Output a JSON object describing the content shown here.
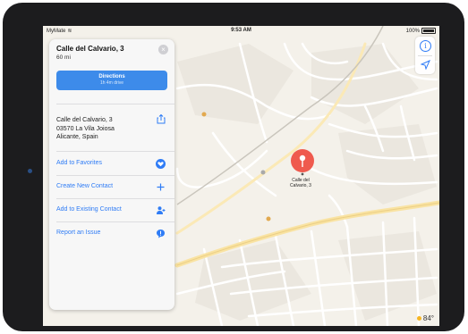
{
  "status": {
    "carrier": "MyMate",
    "time": "9:53 AM",
    "battery": "100%"
  },
  "panel": {
    "title": "Calle del Calvario, 3",
    "distance": "60 mi",
    "directions_label": "Directions",
    "directions_sub": "1h 4m drive",
    "address_line1": "Calle del Calvario, 3",
    "address_line2": "03570 La Vila Joiosa",
    "address_line3": "Alicante, Spain",
    "actions": [
      {
        "label": "Add to Favorites",
        "icon": "heart-icon"
      },
      {
        "label": "Create New Contact",
        "icon": "plus-icon"
      },
      {
        "label": "Add to Existing Contact",
        "icon": "add-person-icon"
      },
      {
        "label": "Report an Issue",
        "icon": "speech-bubble-icon"
      }
    ]
  },
  "pin": {
    "line1": "Calle del",
    "line2": "Calvario, 3"
  },
  "weather": {
    "temp": "84°"
  },
  "colors": {
    "accent": "#2f7cf6",
    "pin": "#ef5a4e",
    "button": "#3d8bea",
    "road": "#f9e3a3"
  }
}
